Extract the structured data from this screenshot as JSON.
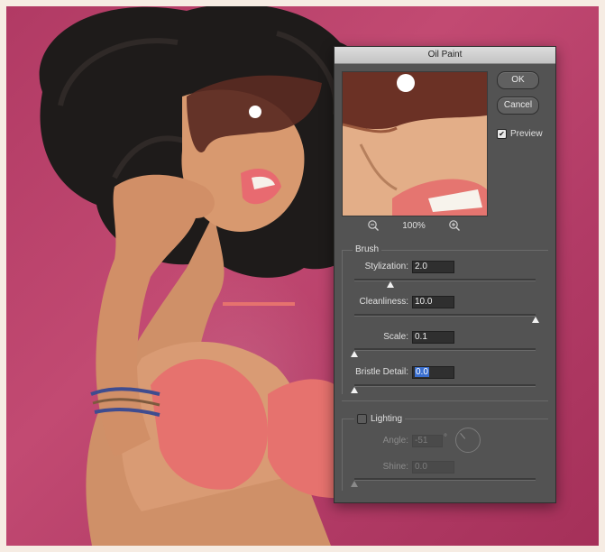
{
  "dialog": {
    "title": "Oil Paint",
    "ok_label": "OK",
    "cancel_label": "Cancel",
    "preview_label": "Preview",
    "preview_checked": true,
    "zoom": "100%"
  },
  "brush": {
    "section_label": "Brush",
    "stylization": {
      "label": "Stylization:",
      "value": "2.0",
      "slider_fraction": 0.2
    },
    "cleanliness": {
      "label": "Cleanliness:",
      "value": "10.0",
      "slider_fraction": 1.0
    },
    "scale": {
      "label": "Scale:",
      "value": "0.1",
      "slider_fraction": 0.0
    },
    "bristle_detail": {
      "label": "Bristle Detail:",
      "value": "0.0",
      "slider_fraction": 0.0
    }
  },
  "lighting": {
    "section_label": "Lighting",
    "checked": false,
    "angle": {
      "label": "Angle:",
      "value": "-51",
      "unit": "°"
    },
    "shine": {
      "label": "Shine:",
      "value": "0.0",
      "slider_fraction": 0.0
    }
  },
  "icons": {
    "zoom_out": "zoom-out-icon",
    "zoom_in": "zoom-in-icon",
    "preview_check": "checkmark-icon"
  },
  "colors": {
    "background_magenta": "#b13a64",
    "dialog_gray": "#535353",
    "selection_blue": "#3a6fd0"
  }
}
